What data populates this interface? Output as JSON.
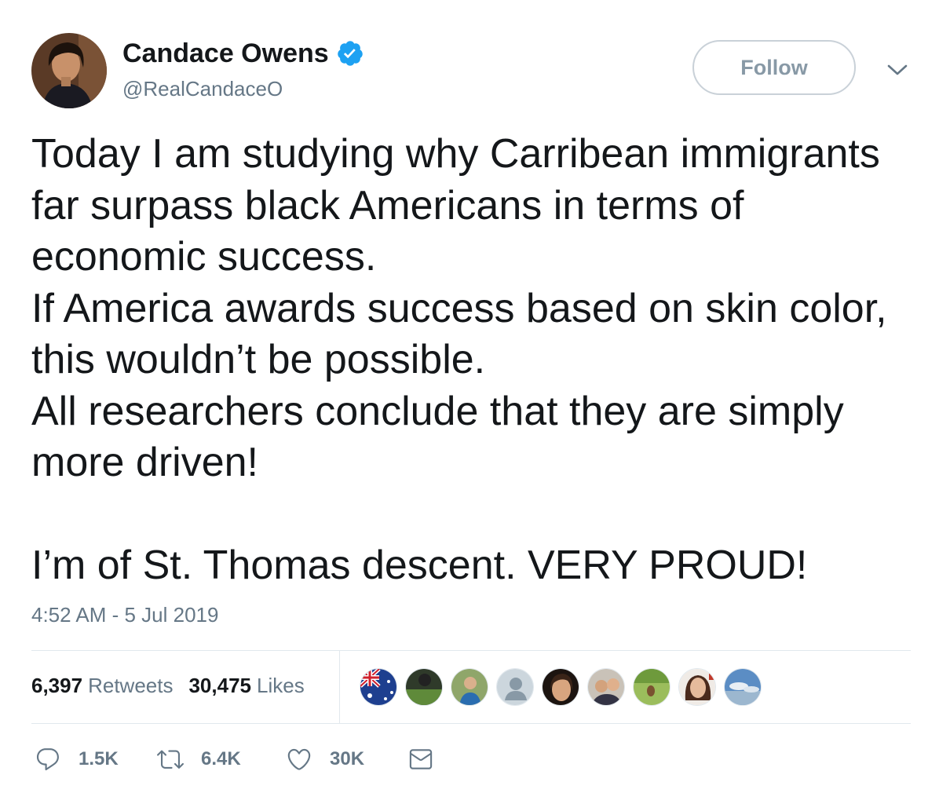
{
  "author": {
    "name": "Candace Owens",
    "handle": "@RealCandaceO",
    "verified": true
  },
  "follow_button": {
    "label": "Follow"
  },
  "tweet_text": "Today I am studying why Carribean immigrants far surpass black Americans in terms of economic success.\nIf America awards success based on skin color, this wouldn’t be possible.\nAll researchers conclude that they are simply more driven!\n\nI’m of St. Thomas descent. VERY PROUD!",
  "timestamp": "4:52 AM - 5 Jul 2019",
  "stats": {
    "retweets_count": "6,397",
    "retweets_label": "Retweets",
    "likes_count": "30,475",
    "likes_label": "Likes"
  },
  "liker_avatars": [
    "flag-avatar",
    "outdoor-avatar",
    "person-avatar",
    "default-avatar",
    "woman-avatar",
    "couple-avatar",
    "field-avatar",
    "woman-avatar",
    "sky-avatar"
  ],
  "actions": {
    "reply_count": "1.5K",
    "retweet_count": "6.4K",
    "like_count": "30K"
  },
  "colors": {
    "text": "#14171a",
    "secondary": "#657786",
    "verified": "#1da1f2",
    "divider": "#e1e8ed"
  }
}
